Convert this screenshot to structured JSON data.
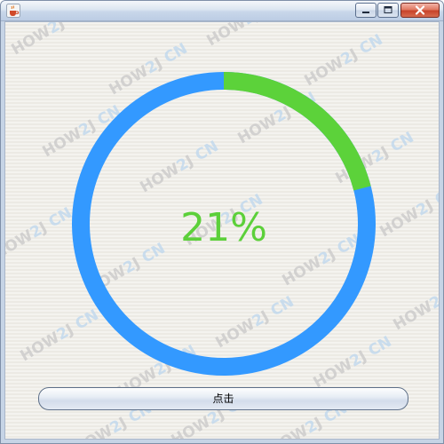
{
  "window": {
    "title": "",
    "app_icon": "java-cup-icon",
    "controls": {
      "minimize_icon": "minimize-icon",
      "maximize_icon": "maximize-icon",
      "close_icon": "close-icon"
    }
  },
  "progress": {
    "value_percent": 21,
    "label": "21%",
    "progress_color": "#5cd23a",
    "track_color": "#3399ff"
  },
  "button": {
    "label": "点击"
  },
  "watermark": {
    "text_left": "HOW",
    "text_digit": "2",
    "text_right": "J",
    "text_suffix": "CN",
    "colors": {
      "main": "#c8c8c8",
      "accent": "#bcd6ee"
    }
  }
}
